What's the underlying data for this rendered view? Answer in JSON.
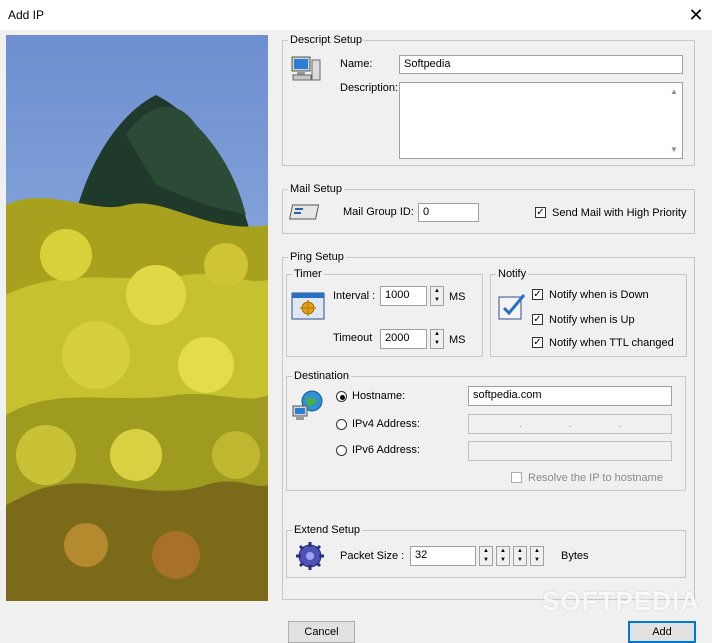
{
  "window": {
    "title": "Add IP",
    "close": "✕"
  },
  "descript": {
    "legend": "Descript  Setup",
    "name_label": "Name:",
    "name_value": "Softpedia",
    "description_label": "Description:",
    "description_value": ""
  },
  "mail": {
    "legend": "Mail  Setup",
    "group_label": "Mail Group ID:",
    "group_value": "0",
    "priority_label": "Send Mail with High Priority",
    "priority_checked": true
  },
  "ping": {
    "legend": "Ping  Setup",
    "timer": {
      "legend": "Timer",
      "interval_label": "Interval :",
      "interval_value": "1000",
      "interval_unit": "MS",
      "timeout_label": "Timeout",
      "timeout_value": "2000",
      "timeout_unit": "MS"
    },
    "notify": {
      "legend": "Notify",
      "down_label": "Notify when is Down",
      "up_label": "Notify when is Up",
      "ttl_label": "Notify when TTL changed"
    }
  },
  "destination": {
    "legend": "Destination",
    "hostname_label": "Hostname:",
    "hostname_value": "softpedia.com",
    "ipv4_label": "IPv4 Address:",
    "ipv6_label": "IPv6 Address:",
    "resolve_label": "Resolve the IP to hostname"
  },
  "extend": {
    "legend": "Extend Setup",
    "packet_label": "Packet Size :",
    "packet_value": "32",
    "packet_unit": "Bytes"
  },
  "buttons": {
    "cancel": "Cancel",
    "add": "Add"
  },
  "watermark": "SOFTPEDIA"
}
